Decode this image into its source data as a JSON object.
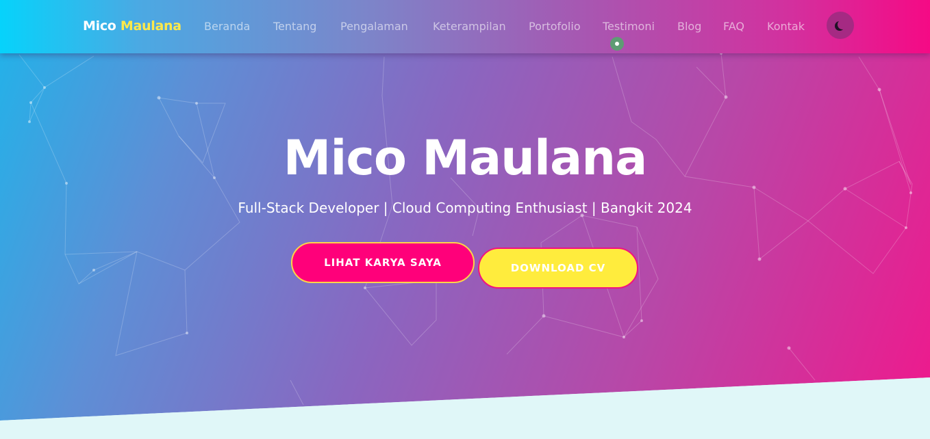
{
  "brand": {
    "first": "Mico",
    "second": "Maulana"
  },
  "nav": {
    "items": [
      "Beranda",
      "Tentang",
      "Pengalaman",
      "Keterampilan",
      "Portofolio",
      "Testimoni",
      "Blog",
      "FAQ",
      "Kontak"
    ],
    "active_indicator_under": "Testimoni",
    "theme_toggle_icon": "moon-icon"
  },
  "hero": {
    "title": "Mico Maulana",
    "subtitle": "Full-Stack Developer | Cloud Computing Enthusiast | Bangkit 2024",
    "primary_button": "LIHAT KARYA SAYA",
    "secondary_button": "DOWNLOAD CV"
  },
  "colors": {
    "accent_yellow": "#ffe94a",
    "primary_pink": "#ff007a",
    "gradient_start": "#06d3fb",
    "gradient_end": "#f50a85",
    "bottom_band": "#e0f7f8"
  }
}
